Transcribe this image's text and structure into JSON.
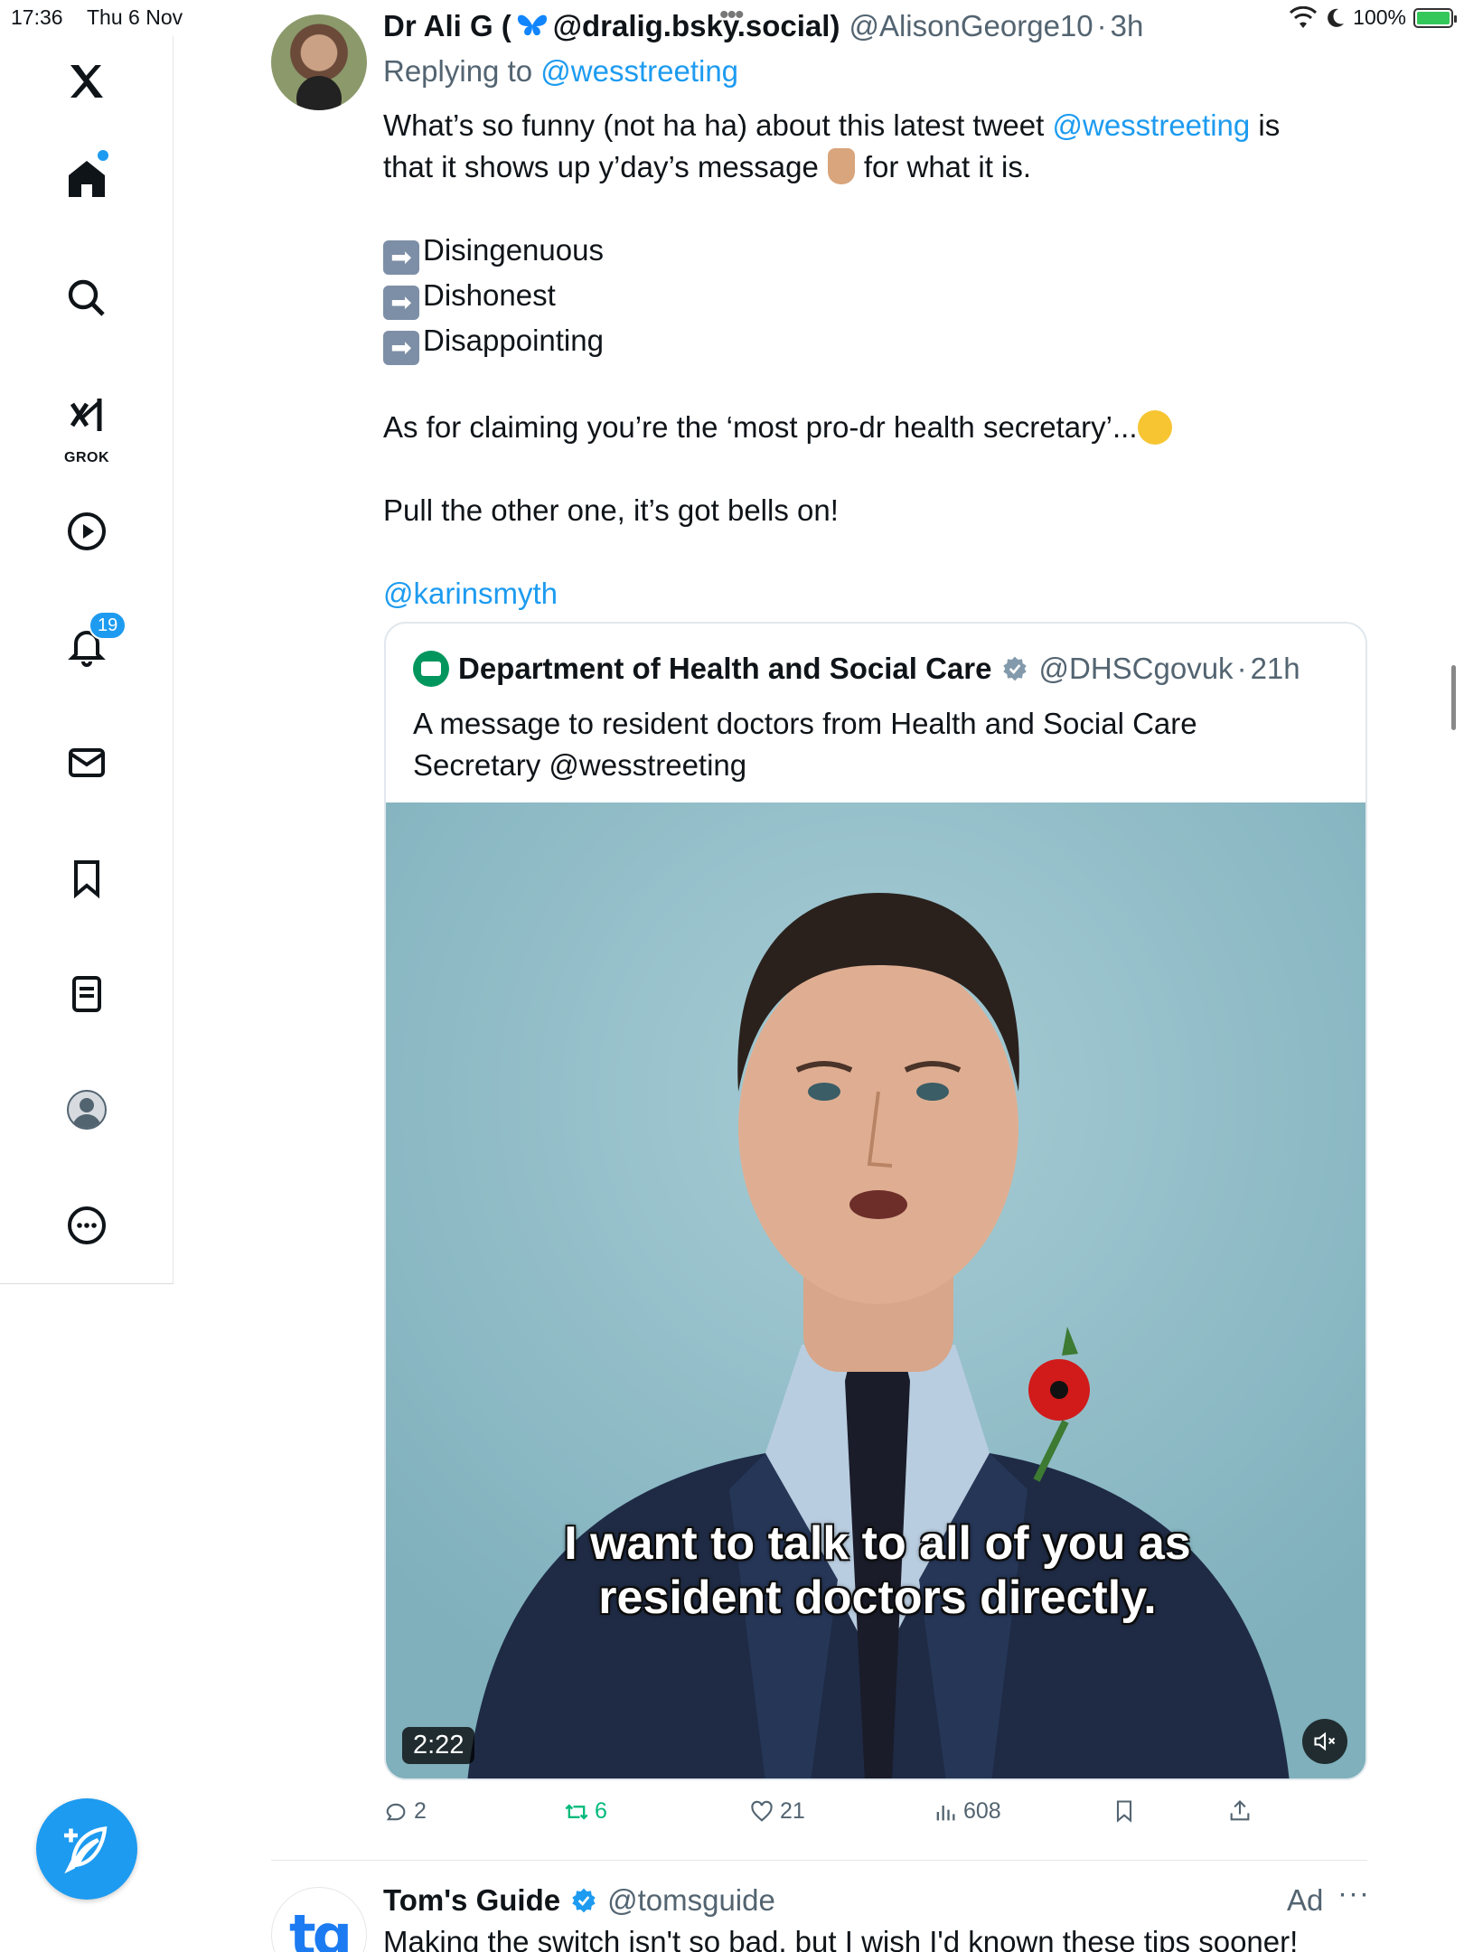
{
  "status_bar": {
    "time": "17:36",
    "date": "Thu 6 Nov",
    "battery": "100%",
    "battery_level": 1.0,
    "battery_color": "#34c759"
  },
  "sidebar": {
    "items": [
      {
        "name": "x-logo",
        "icon": "x-logo-icon"
      },
      {
        "name": "home",
        "icon": "home-icon",
        "has_dot": true
      },
      {
        "name": "search",
        "icon": "search-icon"
      },
      {
        "name": "grok",
        "icon": "grok-icon",
        "label": "GROK"
      },
      {
        "name": "video",
        "icon": "play-icon"
      },
      {
        "name": "notifications",
        "icon": "bell-icon",
        "badge": "19"
      },
      {
        "name": "messages",
        "icon": "mail-icon"
      },
      {
        "name": "bookmarks",
        "icon": "bookmark-icon"
      },
      {
        "name": "lists",
        "icon": "list-icon"
      },
      {
        "name": "profile",
        "icon": "profile-icon"
      },
      {
        "name": "more",
        "icon": "more-icon"
      }
    ],
    "fab_icon": "compose-icon"
  },
  "tweet": {
    "author": "Dr Ali G (",
    "author_handle_in_name": "@dralig.bsky.social)",
    "handle": "@AlisonGeorge10",
    "separator": "·",
    "time": "3h",
    "replying_prefix": "Replying to",
    "replying_to": "@wesstreeting",
    "body": {
      "line1_a": "What’s so funny (not ha ha) about this latest tweet",
      "line1_mention": "@wesstreeting",
      "line1_b": "is",
      "line2_a": "that it shows up y’day’s message",
      "line2_b": "for what it is.",
      "bullets": [
        "Disingenuous",
        "Dishonest",
        "Disappointing"
      ],
      "line_claim": "As for claiming you’re the ‘most pro-dr health secretary’...",
      "line_bells": "Pull the other one, it’s got bells on!",
      "mention_end": "@karinsmyth"
    }
  },
  "quote": {
    "name": "Department of Health and Social Care",
    "handle": "@DHSCgovuk",
    "separator": "·",
    "time": "21h",
    "text_a": "A message to resident doctors from Health and Social Care",
    "text_b": "Secretary @wesstreeting",
    "video": {
      "caption_1": "I want to talk to all of you as",
      "caption_2": "resident doctors directly.",
      "duration": "2:22",
      "muted": true
    }
  },
  "actions": {
    "replies": "2",
    "retweets": "6",
    "likes": "21",
    "views": "608"
  },
  "ad": {
    "avatar_text": "tg",
    "name": "Tom's Guide",
    "handle": "@tomsguide",
    "label": "Ad",
    "more": "···",
    "text": "Making the switch isn't so bad, but I wish I'd known these tips sooner!"
  },
  "colors": {
    "accent": "#1d9bf0",
    "retweet": "#00ba7c",
    "muted_text": "#536471"
  }
}
